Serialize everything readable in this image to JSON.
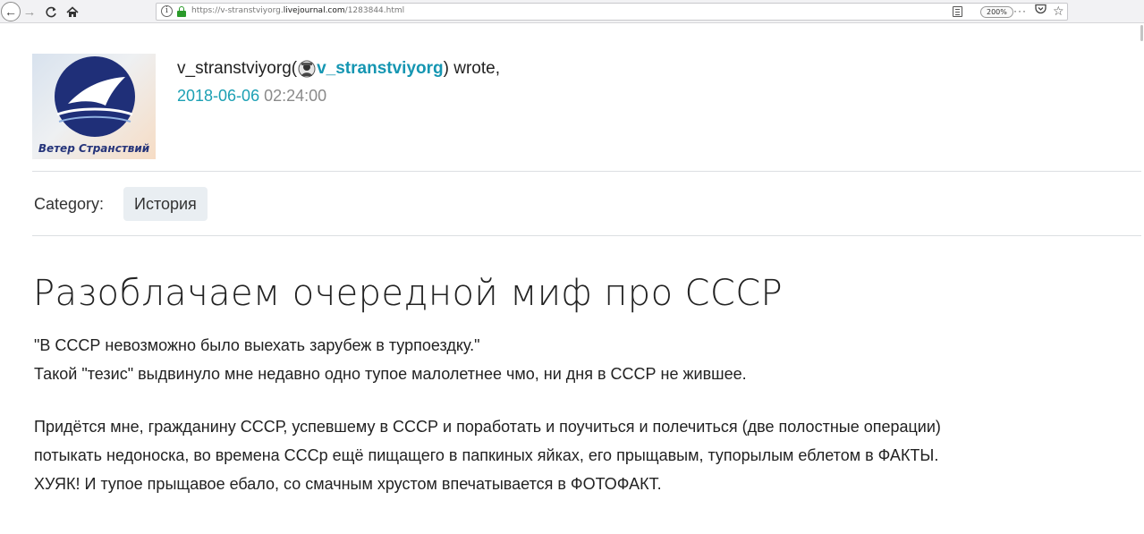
{
  "browser": {
    "url_prefix": "https://v-stranstviyorg.",
    "url_domain": "livejournal.com",
    "url_suffix": "/1283844.html",
    "zoom": "200%",
    "more": "···"
  },
  "author": {
    "avatar_caption": "Ветер Странствий",
    "username": "v_stranstviyorg",
    "open_paren": " (",
    "journal_link": "v_stranstviyorg",
    "close_wrote": ") wrote,",
    "date": "2018-06-06",
    "time": " 02:24:00"
  },
  "category": {
    "label": "Category:",
    "tag": "История"
  },
  "post": {
    "title": "Разоблачаем очередной миф про СССР",
    "lines": [
      "\"В СССР невозможно было выехать зарубеж в турпоездку.\"",
      "Такой \"тезис\" выдвинуло мне недавно одно тупое малолетнее чмо, ни дня в СССР не жившее.",
      "Придётся мне, гражданину СССР, успевшему в СССР и поработать и поучиться и полечиться (две полостные операции)",
      "потыкать недоноска, во времена СССр ещё пищащего в папкиных яйках, его прыщавым, тупорылым еблетом в ФАКТЫ.",
      "ХУЯК! И тупое прыщавое ебало, со смачным хрустом впечатывается в ФОТОФАКТ."
    ]
  },
  "colors": {
    "link": "#1596b2",
    "date": "#1ca0b4",
    "tag_bg": "#e9eef2",
    "logo_navy": "#25347a"
  },
  "icons": [
    "back-arrow-icon",
    "forward-arrow-icon",
    "reload-icon",
    "home-icon",
    "info-icon",
    "lock-icon",
    "reader-view-icon",
    "more-icon",
    "pocket-icon",
    "bookmark-star-icon",
    "user-icon"
  ]
}
